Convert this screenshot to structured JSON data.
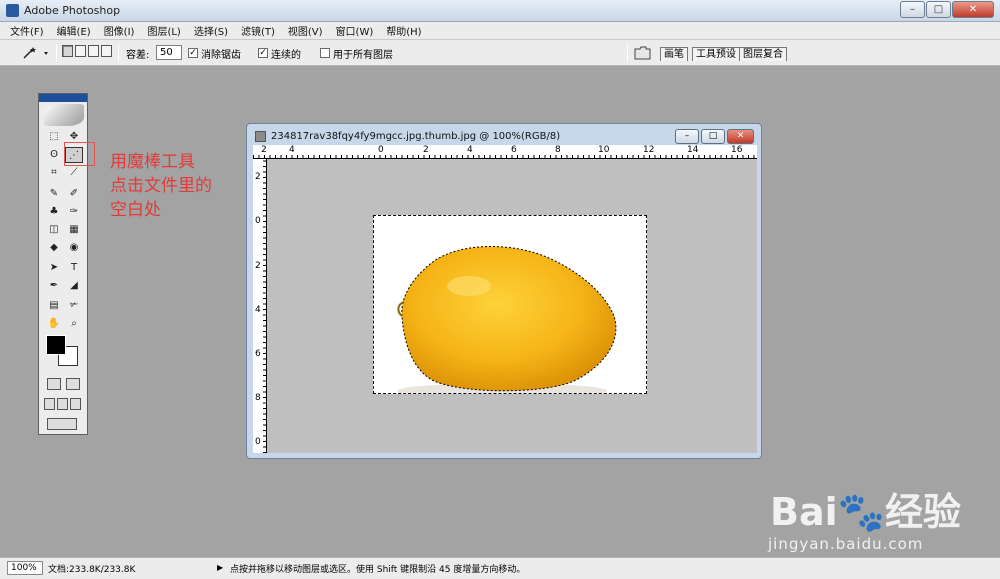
{
  "window": {
    "title": "Adobe Photoshop",
    "min": "–",
    "max": "□",
    "close": "✕"
  },
  "menubar": [
    "文件(F)",
    "编辑(E)",
    "图像(I)",
    "图层(L)",
    "选择(S)",
    "滤镜(T)",
    "视图(V)",
    "窗口(W)",
    "帮助(H)"
  ],
  "options": {
    "tolerance_label": "容差:",
    "tolerance_value": "50",
    "antialias_label": "消除锯齿",
    "antialias_checked": "✓",
    "contiguous_label": "连续的",
    "contiguous_checked": "✓",
    "all_layers_label": "用于所有图层",
    "palette_tabs": [
      "画笔",
      "工具预设",
      "图层复合"
    ]
  },
  "toolbox": {
    "icons": [
      "marquee-icon",
      "move-icon",
      "lasso-icon",
      "magic-wand-icon",
      "crop-icon",
      "slice-icon",
      "healing-icon",
      "brush-icon",
      "stamp-icon",
      "history-brush-icon",
      "eraser-icon",
      "gradient-icon",
      "blur-icon",
      "dodge-icon",
      "path-select-icon",
      "type-icon",
      "pen-icon",
      "shape-icon",
      "notes-icon",
      "eyedropper-icon",
      "hand-icon",
      "zoom-icon"
    ],
    "glyphs": [
      "⬚",
      "✥",
      "ʘ",
      "⋰",
      "⌗",
      "⟋",
      "✎",
      "✐",
      "♣",
      "✑",
      "◫",
      "▦",
      "◆",
      "◉",
      "➤",
      "T",
      "✒",
      "◢",
      "▤",
      "✃",
      "✋",
      "⌕"
    ],
    "fg_color": "#000000",
    "bg_color": "#ffffff"
  },
  "annotation": {
    "lines": [
      "用魔棒工具",
      "点击文件里的",
      "空白处"
    ],
    "color": "#e13b3b"
  },
  "document": {
    "title": "234817rav38fqy4fy9mgcc.jpg.thumb.jpg @ 100%(RGB/8)",
    "min": "–",
    "max": "□",
    "close": "✕",
    "ruler_top": [
      "2",
      "4",
      "0",
      "2",
      "4",
      "6",
      "8",
      "10",
      "12",
      "14",
      "16"
    ],
    "ruler_left": [
      "2",
      "0",
      "2",
      "4",
      "6",
      "8",
      "0"
    ]
  },
  "status": {
    "zoom": "100%",
    "doc_info": "文档:233.8K/233.8K",
    "arrow": "▶",
    "hint": "点按并拖移以移动图层或选区。使用 Shift 键限制沿 45 度增量方向移动。"
  },
  "watermark": {
    "logo": "Bai🐾经验",
    "url": "jingyan.baidu.com"
  },
  "colors": {
    "workspace": "#a3a3a3",
    "canvas_bg": "#bfbfbf",
    "lemon": "#f5b416",
    "annotation": "#e13b3b"
  }
}
